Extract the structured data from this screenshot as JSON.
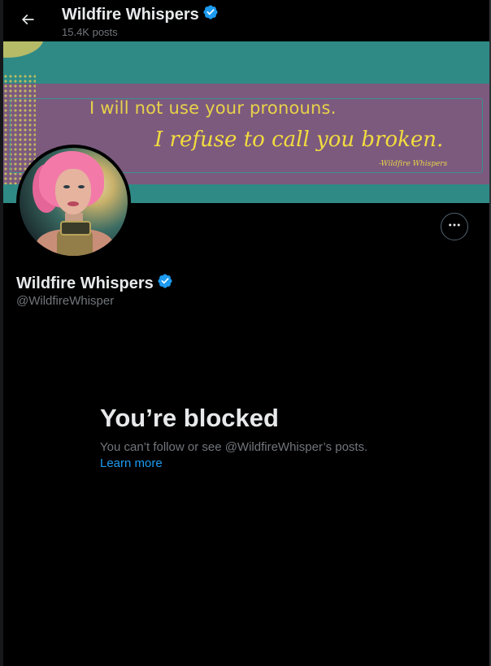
{
  "header": {
    "title": "Wildfire Whispers",
    "post_count": "15.4K posts"
  },
  "banner": {
    "quote_line_1": "I will not use your pronouns.",
    "quote_line_2": "I refuse to call you broken.",
    "signature": "-Wildfire Whispers"
  },
  "profile": {
    "display_name": "Wildfire Whispers",
    "handle": "@WildfireWhisper",
    "verified_color": "#1d9bf0"
  },
  "blocked": {
    "title": "You’re blocked",
    "description": "You can’t follow or see @WildfireWhisper’s posts.",
    "link": "Learn more"
  },
  "icons": {
    "back": "arrow-left-icon",
    "verified": "verified-badge-icon",
    "more": "more-horizontal-icon"
  },
  "colors": {
    "background": "#000000",
    "accent": "#1d9bf0",
    "muted_text": "#71767b",
    "banner_teal": "#2f8a86",
    "banner_purple": "#7c5a7e",
    "banner_text": "#e8d24a"
  }
}
